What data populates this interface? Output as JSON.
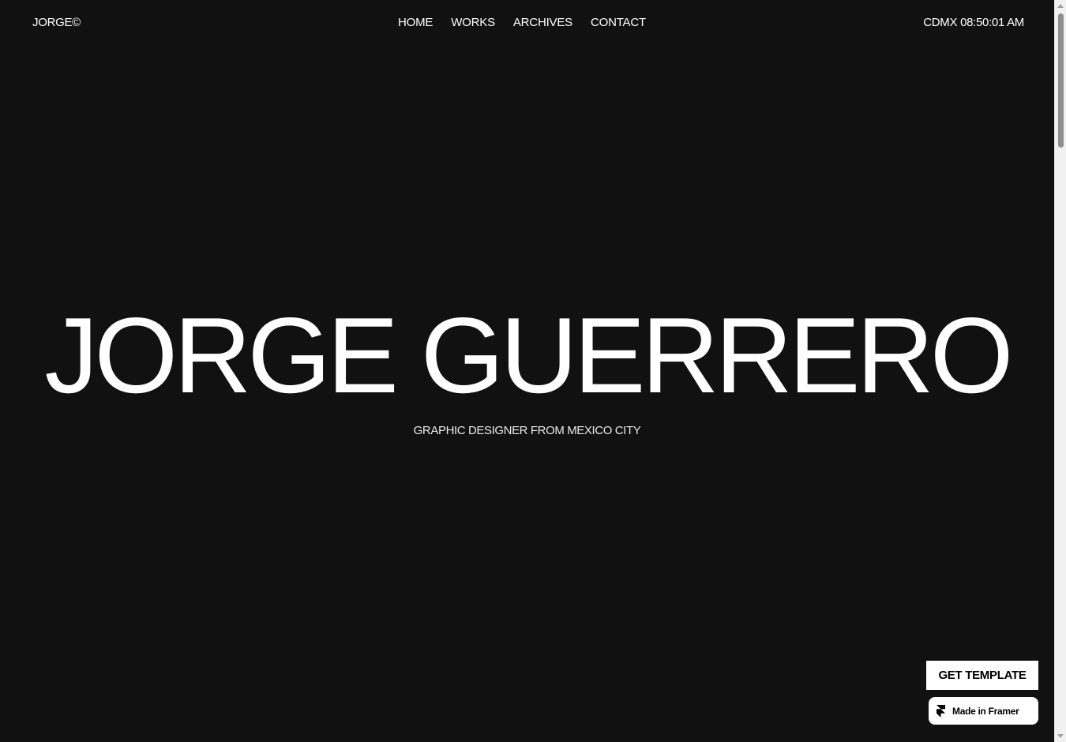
{
  "header": {
    "logo": "JORGE©",
    "nav": [
      "HOME",
      "WORKS",
      "ARCHIVES",
      "CONTACT"
    ],
    "clock": "CDMX 08:50:01 AM"
  },
  "hero": {
    "title": "JORGE GUERRERO",
    "subtitle": "GRAPHIC DESIGNER FROM MEXICO CITY"
  },
  "cta": {
    "get_template": "GET TEMPLATE",
    "made_in_framer": "Made in Framer"
  },
  "icons": {
    "framer_logo": "framer-logo-icon"
  },
  "colors": {
    "background": "#111111",
    "text": "#ffffff",
    "button_bg": "#ffffff",
    "button_text": "#000000"
  }
}
